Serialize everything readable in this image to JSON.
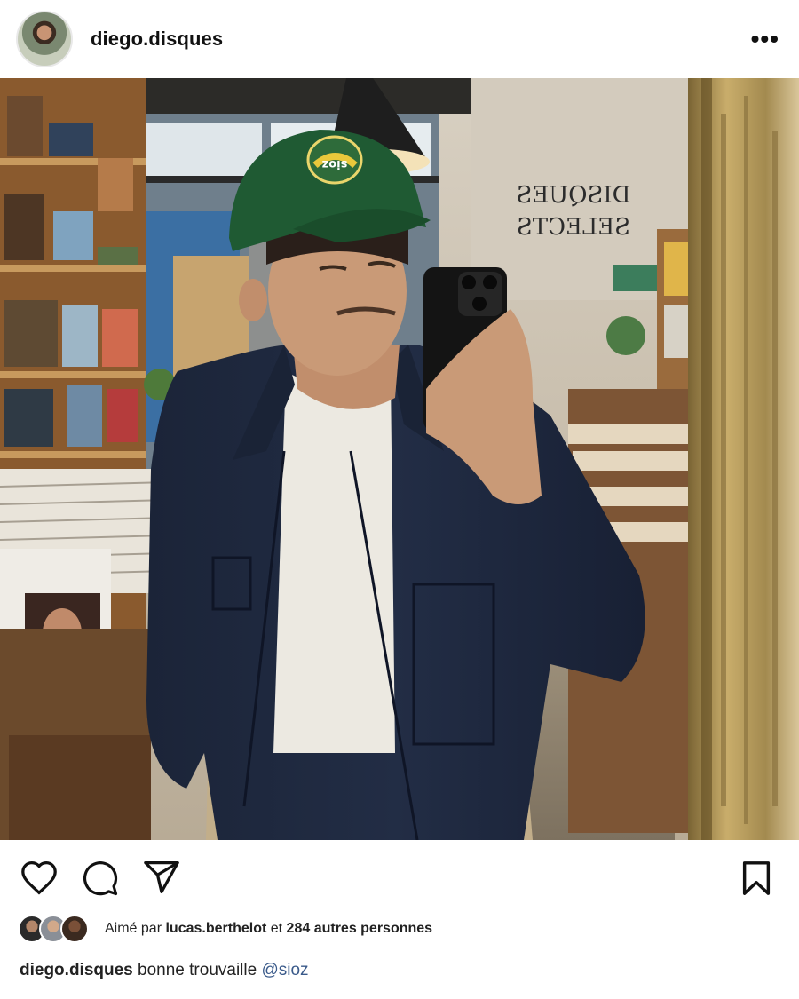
{
  "post": {
    "username": "diego.disques",
    "more_label": "•••"
  },
  "photo": {
    "shop_sign_line1": "DISQUES",
    "shop_sign_line2": "SELECTS",
    "cap_patch": "sioz"
  },
  "likes": {
    "prefix": "Aimé par",
    "first_liker": "lucas.berthelot",
    "connector": "et",
    "others": "284 autres personnes"
  },
  "caption": {
    "username": "diego.disques",
    "text": "bonne trouvaille",
    "mention": "@sioz"
  },
  "icons": {
    "like": "heart-icon",
    "comment": "comment-icon",
    "share": "send-icon",
    "save": "bookmark-icon",
    "more": "more-options-icon"
  }
}
